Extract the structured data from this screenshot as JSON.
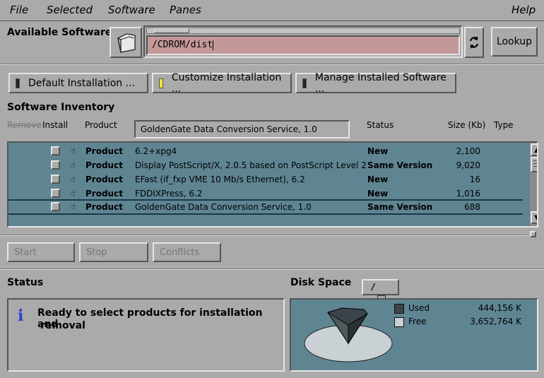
{
  "menu": {
    "file": "File",
    "selected": "Selected",
    "software": "Software",
    "panes": "Panes",
    "help": "Help"
  },
  "available_software": {
    "label": "Available Software:",
    "path": "/CDROM/dist",
    "lookup": "Lookup"
  },
  "install_buttons": {
    "default": "Default Installation ...",
    "customize": "Customize Installation ...",
    "manage": "Manage Installed Software ..."
  },
  "inventory": {
    "title": "Software Inventory",
    "headers": {
      "remove": "Remove",
      "install": "Install",
      "product": "Product",
      "status": "Status",
      "size": "Size (Kb)",
      "type": "Type"
    },
    "selected_name": "GoldenGate Data Conversion Service, 1.0",
    "rows": [
      {
        "kind": "Product",
        "name": "6.2+xpg4",
        "status": "New",
        "size": "2,100"
      },
      {
        "kind": "Product",
        "name": "Display PostScript/X, 2.0.5 based on PostScript Level 2",
        "status": "Same Version",
        "size": "9,020"
      },
      {
        "kind": "Product",
        "name": "EFast (if_fxp VME 10 Mb/s Ethernet), 6.2",
        "status": "New",
        "size": "16"
      },
      {
        "kind": "Product",
        "name": "FDDIXPress, 6.2",
        "status": "New",
        "size": "1,016"
      },
      {
        "kind": "Product",
        "name": "GoldenGate Data Conversion Service, 1.0",
        "status": "Same Version",
        "size": "688"
      }
    ]
  },
  "actions": {
    "start": "Start",
    "stop": "Stop",
    "conflicts": "Conflicts"
  },
  "status": {
    "title": "Status",
    "message_line1": "Ready to select products for installation and",
    "message_line2": "removal"
  },
  "disk": {
    "title": "Disk Space",
    "fs_button": "/",
    "used_label": "Used",
    "used_value": "444,156 K",
    "free_label": "Free",
    "free_value": "3,652,764 K",
    "used_color": "#3a4449",
    "free_color": "#c9d1d4"
  }
}
